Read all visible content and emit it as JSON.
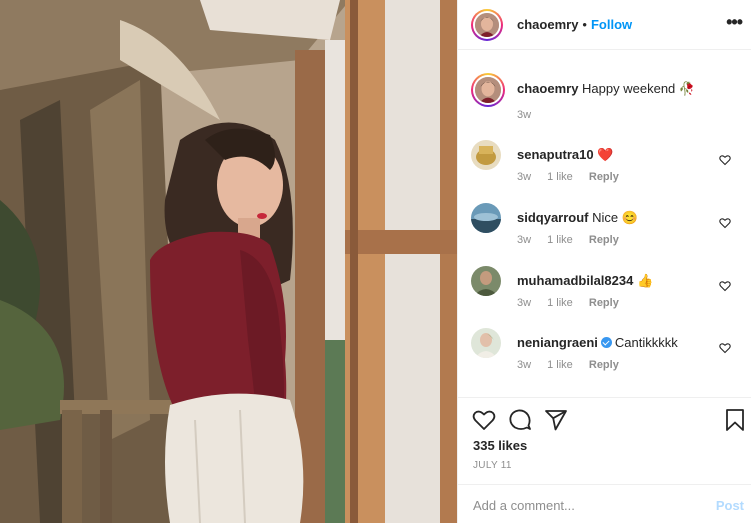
{
  "post": {
    "author": "chaoemry",
    "follow_label": "Follow",
    "separator": "•",
    "more_label": "•••",
    "caption": {
      "username": "chaoemry",
      "text": "Happy weekend",
      "emoji": "🥀",
      "age": "3w"
    }
  },
  "comments": [
    {
      "username": "senaputra10",
      "text": "❤️",
      "age": "3w",
      "likes": "1 like",
      "reply": "Reply",
      "verified": false
    },
    {
      "username": "sidqyarrouf",
      "text": "Nice 😊",
      "age": "3w",
      "likes": "1 like",
      "reply": "Reply",
      "verified": false
    },
    {
      "username": "muhamadbilal8234",
      "text": "👍",
      "age": "3w",
      "likes": "1 like",
      "reply": "Reply",
      "verified": false
    },
    {
      "username": "neniangraeni",
      "text": "Cantikkkkk",
      "age": "3w",
      "likes": "1 like",
      "reply": "Reply",
      "verified": true
    }
  ],
  "stats": {
    "likes": "335 likes",
    "date": "JULY 11"
  },
  "composer": {
    "placeholder": "Add a comment...",
    "post_label": "Post"
  },
  "icons": {
    "like": "heart-icon",
    "comment": "speech-bubble-icon",
    "share": "paper-plane-icon",
    "save": "bookmark-icon",
    "more": "more-dots-icon"
  },
  "colors": {
    "link": "#0095f6",
    "post_disabled": "#b3dbff",
    "heart_red": "#ed4956",
    "muted": "#8e8e8e",
    "sweater": "#7d1f2b"
  }
}
